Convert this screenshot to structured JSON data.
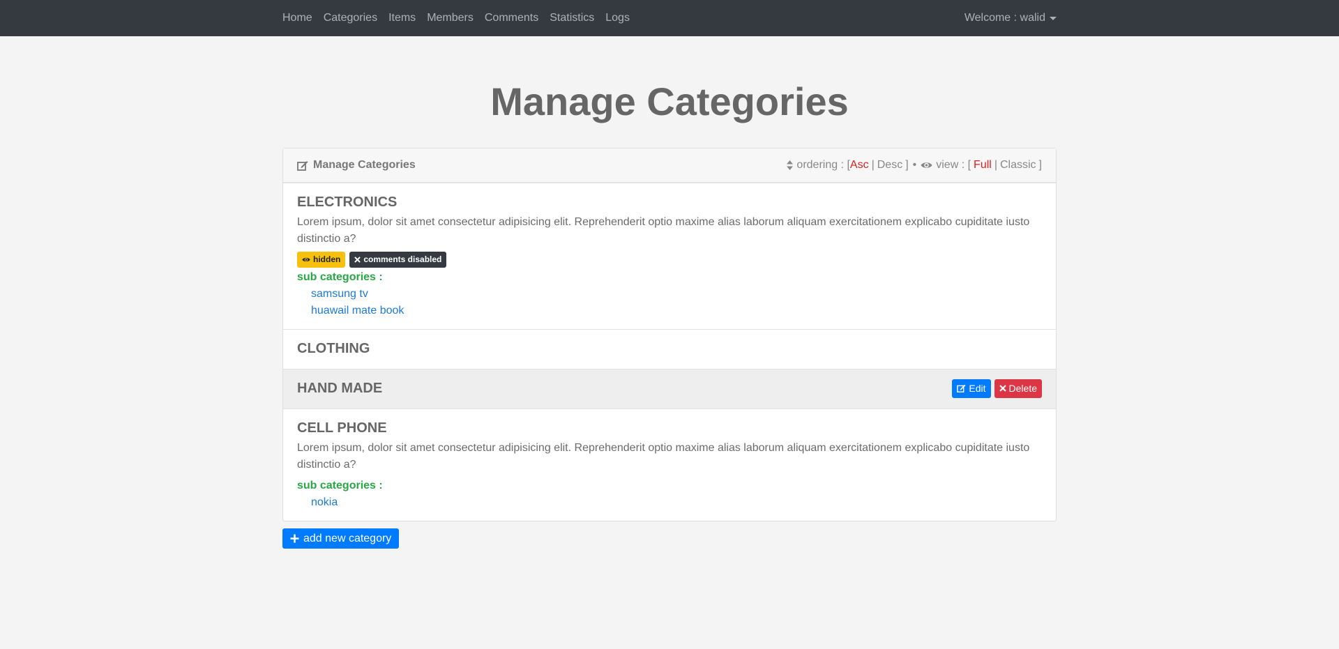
{
  "nav": {
    "links": [
      "Home",
      "Categories",
      "Items",
      "Members",
      "Comments",
      "Statistics",
      "Logs"
    ],
    "user_label": "Welcome : walid"
  },
  "page_title": "Manage Categories",
  "panel": {
    "title": "Manage Categories",
    "ordering_label": "ordering : [",
    "asc": "Asc",
    "desc": "Desc",
    "close_bracket": "]",
    "bullet": "•",
    "view_label": "view : [",
    "full": "Full",
    "classic": "Classic",
    "view_close": "]"
  },
  "categories": [
    {
      "name": "ELECTRONICS",
      "description": "Lorem ipsum, dolor sit amet consectetur adipisicing elit. Reprehenderit optio maxime alias laborum aliquam exercitationem explicabo cupiditate iusto distinctio a?",
      "badge_hidden": "hidden",
      "badge_comments": "comments disabled",
      "sub_title": "sub categories :",
      "subs": [
        "samsung tv",
        "huawail mate book"
      ]
    },
    {
      "name": "CLOTHING"
    },
    {
      "name": "HAND MADE",
      "edit": "Edit",
      "delete": "Delete"
    },
    {
      "name": "CELL PHONE",
      "description": "Lorem ipsum, dolor sit amet consectetur adipisicing elit. Reprehenderit optio maxime alias laborum aliquam exercitationem explicabo cupiditate iusto distinctio a?",
      "sub_title": "sub categories :",
      "subs": [
        "nokia"
      ]
    }
  ],
  "add_button": "add new category",
  "colors": {
    "navbar": "#343a40",
    "primary": "#007bff",
    "danger": "#dc3545",
    "warning": "#f7c00d",
    "success": "#28a745",
    "active_option": "#dc1f1f"
  }
}
